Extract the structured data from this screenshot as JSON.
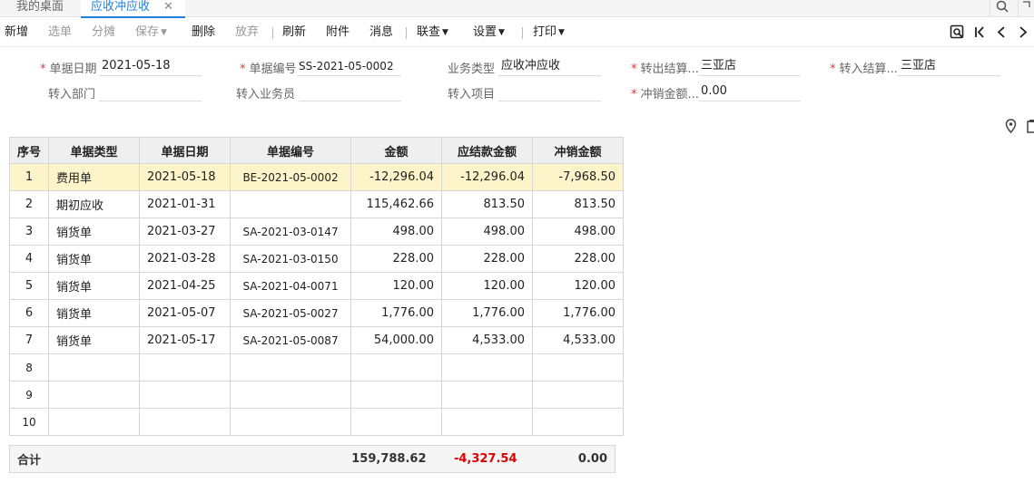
{
  "tabs": [
    {
      "label": "我的桌面"
    },
    {
      "label": "应收冲应收",
      "close": "✕"
    }
  ],
  "toolbar": {
    "new": "新增",
    "select_bill": "选单",
    "split": "分摊",
    "save": "保存",
    "delete": "删除",
    "discard": "放弃",
    "refresh": "刷新",
    "attachment": "附件",
    "message": "消息",
    "link_query": "联查",
    "settings": "设置",
    "print": "打印"
  },
  "form": {
    "bill_date": {
      "label": "单据日期",
      "value": "2021-05-18"
    },
    "bill_no": {
      "label": "单据编号",
      "value": "SS-2021-05-0002"
    },
    "biz_type": {
      "label": "业务类型",
      "value": "应收冲应收"
    },
    "out_settle": {
      "label": "转出结算...",
      "value": "三亚店"
    },
    "in_settle": {
      "label": "转入结算...",
      "value": "三亚店"
    },
    "in_dept": {
      "label": "转入部门",
      "value": ""
    },
    "in_staff": {
      "label": "转入业务员",
      "value": ""
    },
    "in_project": {
      "label": "转入项目",
      "value": ""
    },
    "writeoff_amount": {
      "label": "冲销金额...",
      "value": "0.00"
    }
  },
  "table": {
    "headers": [
      "序号",
      "单据类型",
      "单据日期",
      "单据编号",
      "金额",
      "应结款金额",
      "冲销金额"
    ],
    "rows": [
      {
        "idx": "1",
        "type": "费用单",
        "date": "2021-05-18",
        "no": "BE-2021-05-0002",
        "amount": "-12,296.04",
        "due": "-12,296.04",
        "writeoff": "-7,968.50"
      },
      {
        "idx": "2",
        "type": "期初应收",
        "date": "2021-01-31",
        "no": "",
        "amount": "115,462.66",
        "due": "813.50",
        "writeoff": "813.50"
      },
      {
        "idx": "3",
        "type": "销货单",
        "date": "2021-03-27",
        "no": "SA-2021-03-0147",
        "amount": "498.00",
        "due": "498.00",
        "writeoff": "498.00"
      },
      {
        "idx": "4",
        "type": "销货单",
        "date": "2021-03-28",
        "no": "SA-2021-03-0150",
        "amount": "228.00",
        "due": "228.00",
        "writeoff": "228.00"
      },
      {
        "idx": "5",
        "type": "销货单",
        "date": "2021-04-25",
        "no": "SA-2021-04-0071",
        "amount": "120.00",
        "due": "120.00",
        "writeoff": "120.00"
      },
      {
        "idx": "6",
        "type": "销货单",
        "date": "2021-05-07",
        "no": "SA-2021-05-0027",
        "amount": "1,776.00",
        "due": "1,776.00",
        "writeoff": "1,776.00"
      },
      {
        "idx": "7",
        "type": "销货单",
        "date": "2021-05-17",
        "no": "SA-2021-05-0087",
        "amount": "54,000.00",
        "due": "4,533.00",
        "writeoff": "4,533.00"
      }
    ],
    "empty_rows": [
      "8",
      "9",
      "10"
    ]
  },
  "totals": {
    "label": "合计",
    "amount": "159,788.62",
    "due": "-4,327.54",
    "writeoff": "0.00"
  },
  "colors": {
    "accent": "#1e7fdc",
    "link": "#2331c4",
    "negative": "#e10000",
    "selected_row": "#fdf4c9"
  }
}
